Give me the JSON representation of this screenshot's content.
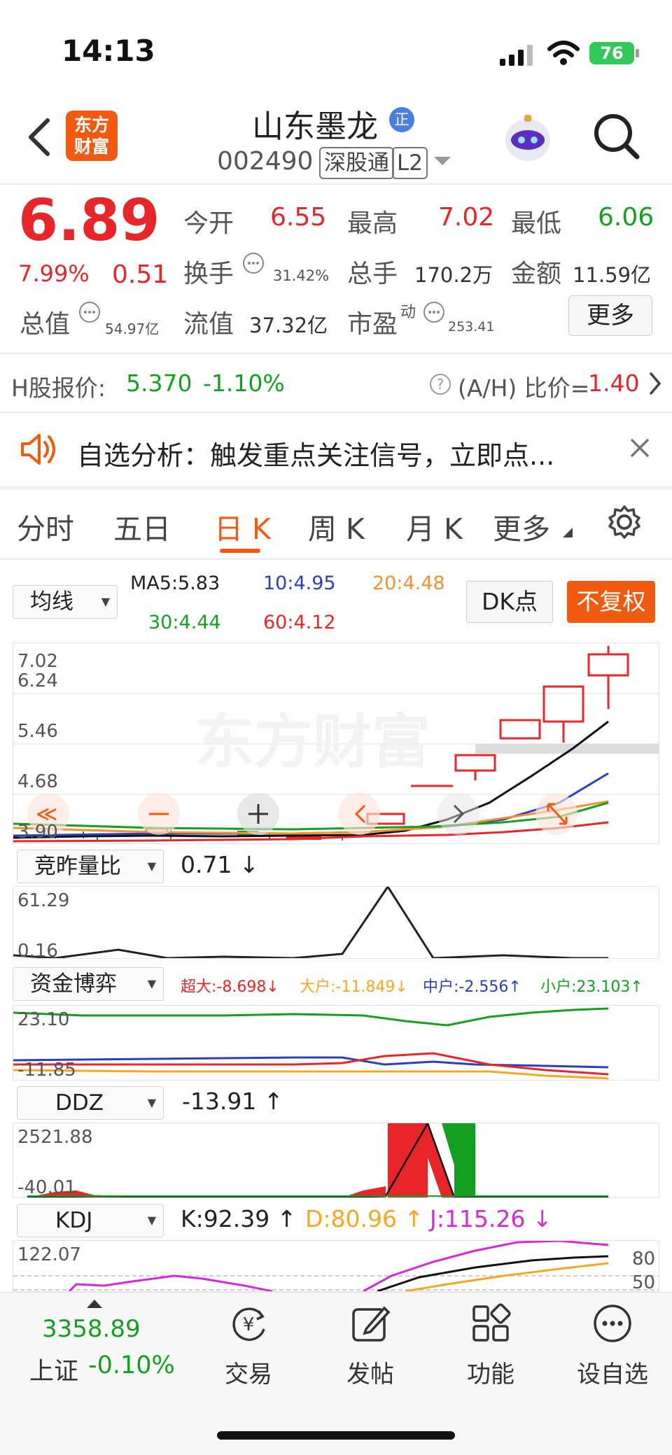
{
  "status_bar": {
    "time": "14:13",
    "battery": "76"
  },
  "header": {
    "logo_line1": "东方",
    "logo_line2": "财富",
    "stock_name": "山东墨龙",
    "badge": "正",
    "code": "002490",
    "tag1": "深股通",
    "tag2": "L2"
  },
  "quote": {
    "price": "6.89",
    "change_pct": "7.99%",
    "change": "0.51",
    "open_label": "今开",
    "open": "6.55",
    "high_label": "最高",
    "high": "7.02",
    "low_label": "最低",
    "low": "6.06",
    "turnover_label": "换手",
    "turnover": "31.42%",
    "volume_label": "总手",
    "volume": "170.2万",
    "amount_label": "金额",
    "amount": "11.59亿",
    "mktcap_label": "总值",
    "mktcap": "54.97亿",
    "float_label": "流值",
    "float": "37.32亿",
    "pe_label": "市盈",
    "pe_sup": "动",
    "pe": "253.41",
    "more_button": "更多"
  },
  "hshare": {
    "label": "H股报价:",
    "price": "5.370",
    "change": "-1.10%",
    "ratio_label": "(A/H) 比价=",
    "ratio": "1.40"
  },
  "notice": {
    "text": "自选分析：触发重点关注信号，立即点..."
  },
  "tabs": [
    "分时",
    "五日",
    "日 K",
    "周 K",
    "月 K",
    "更多"
  ],
  "active_tab": "日 K",
  "ma": {
    "selector": "均线",
    "ma5": "MA5:5.83",
    "ma10": "10:4.95",
    "ma20": "20:4.48",
    "ma30": "30:4.44",
    "ma60": "60:4.12",
    "dk_button": "DK点",
    "fq_button": "不复权"
  },
  "kline": {
    "y_labels": [
      "7.02",
      "6.24",
      "5.46",
      "4.68",
      "3.90"
    ],
    "watermark": "东方财富"
  },
  "ind1": {
    "selector": "竞昨量比",
    "value": "0.71",
    "y_top": "61.29",
    "y_bottom": "0.16"
  },
  "ind2": {
    "selector": "资金博弈",
    "super": "超大:-8.698",
    "large": "大户:-11.849",
    "mid": "中户:-2.556",
    "small": "小户:23.103",
    "y_top": "23.10",
    "y_bottom": "-11.85"
  },
  "ind3": {
    "selector": "DDZ",
    "value": "-13.91",
    "y_top": "2521.88",
    "y_bottom": "-40.01"
  },
  "ind4": {
    "selector": "KDJ",
    "k": "K:92.39",
    "d": "D:80.96",
    "j": "J:115.26",
    "y_top": "122.07",
    "r80": "80",
    "r50": "50"
  },
  "bottom": {
    "index_value": "3358.89",
    "index_name": "上证",
    "index_change": "-0.10%",
    "trade": "交易",
    "post": "发帖",
    "func": "功能",
    "watch": "设自选"
  },
  "colors": {
    "red": "#e8262a",
    "green": "#13a020",
    "accent": "#f25a0f",
    "blue": "#2a3fbf",
    "orange": "#f5902a"
  }
}
